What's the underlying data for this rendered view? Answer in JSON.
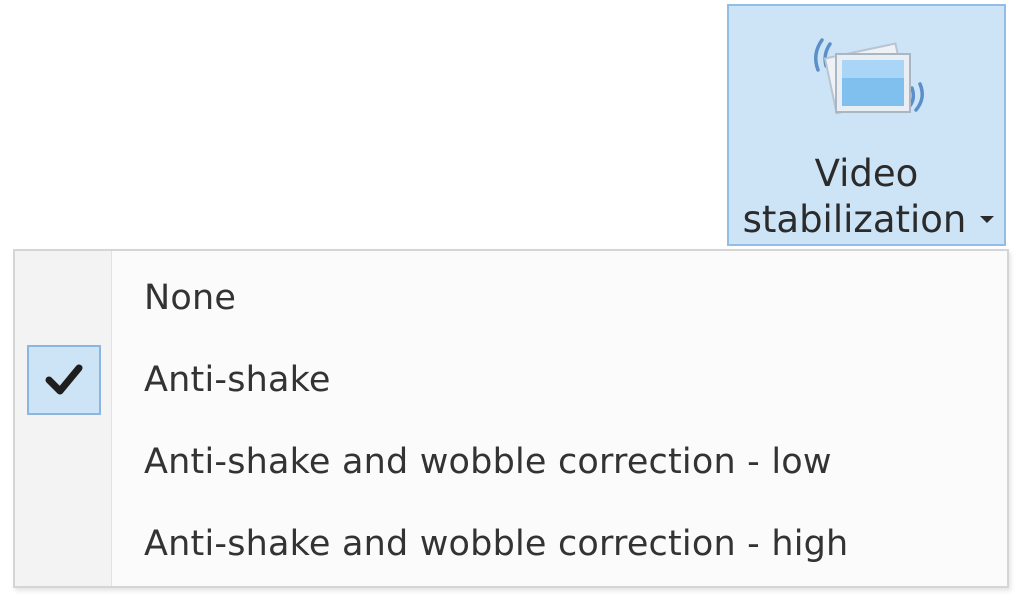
{
  "ribbon": {
    "button": {
      "label_line1": "Video",
      "label_line2": "stabilization",
      "icon": "video-stabilization-icon",
      "state": "pressed",
      "has_dropdown": true
    }
  },
  "menu": {
    "items": [
      {
        "label": "None",
        "checked": false
      },
      {
        "label": "Anti-shake",
        "checked": true
      },
      {
        "label": "Anti-shake and wobble correction - low",
        "checked": false
      },
      {
        "label": "Anti-shake and wobble correction - high",
        "checked": false
      }
    ]
  },
  "colors": {
    "highlight_fill": "#cde4f7",
    "highlight_border": "#93bde6",
    "text": "#333333",
    "menu_background": "#fbfbfb",
    "menu_border": "#d5d5d5"
  }
}
